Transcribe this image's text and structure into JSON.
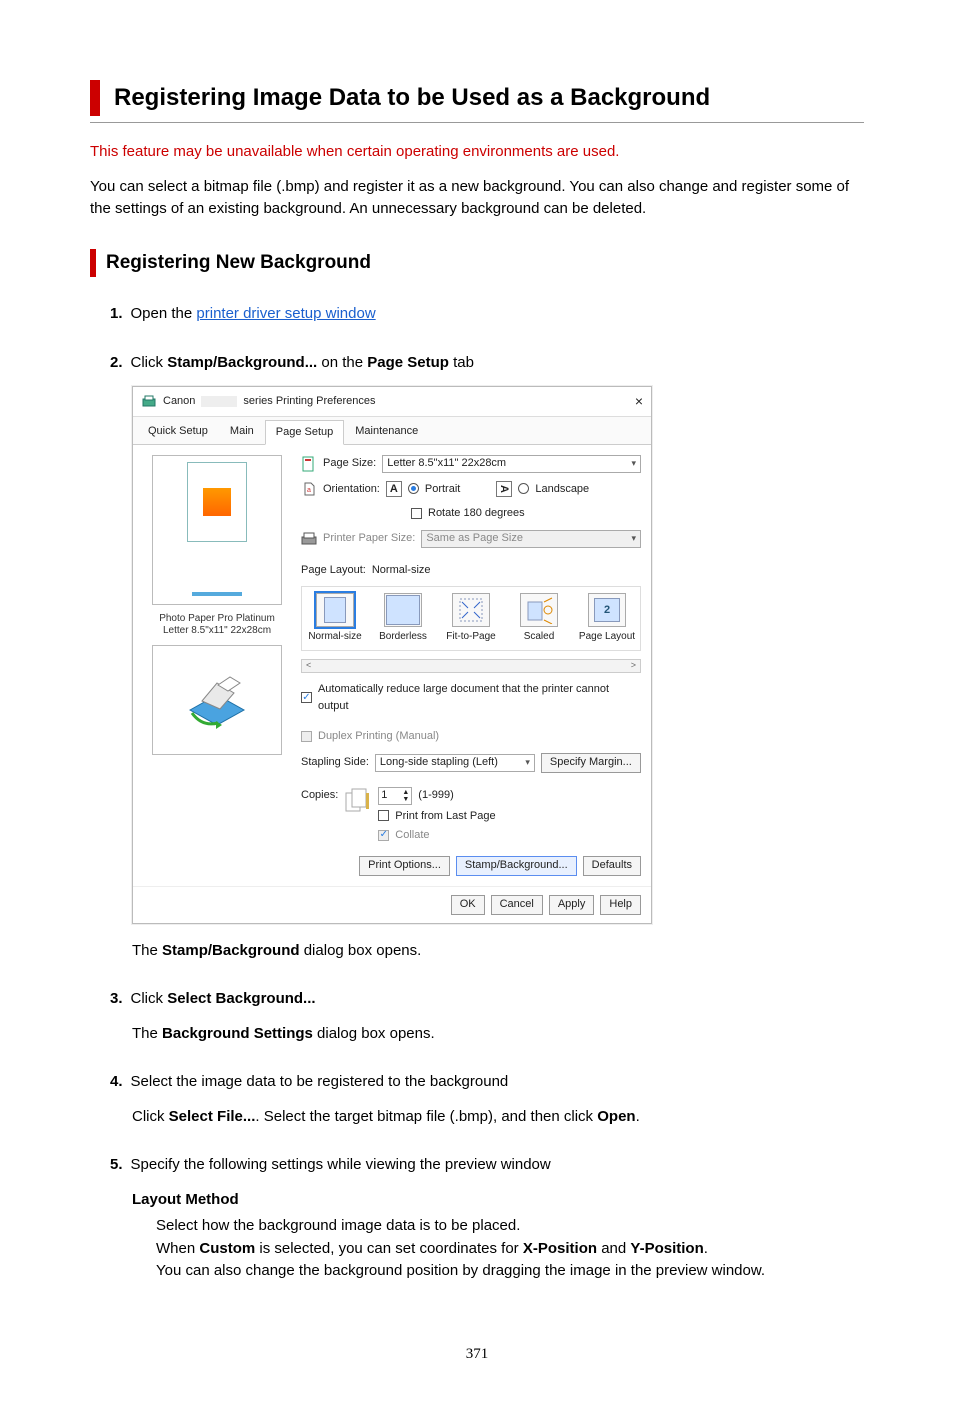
{
  "title": "Registering Image Data to be Used as a Background",
  "warning": "This feature may be unavailable when certain operating environments are used.",
  "intro": "You can select a bitmap file (.bmp) and register it as a new background. You can also change and register some of the settings of an existing background. An unnecessary background can be deleted.",
  "section_heading": "Registering New Background",
  "steps": {
    "s1": {
      "num": "1.",
      "pre": "Open the ",
      "link": "printer driver setup window"
    },
    "s2": {
      "num": "2.",
      "pre": "Click ",
      "b1": "Stamp/Background...",
      "mid": " on the ",
      "b2": "Page Setup",
      "post": " tab",
      "after_para_pre": "The ",
      "after_para_b": "Stamp/Background",
      "after_para_post": " dialog box opens."
    },
    "s3": {
      "num": "3.",
      "pre": "Click ",
      "b1": "Select Background...",
      "after_pre": "The ",
      "after_b": "Background Settings",
      "after_post": " dialog box opens."
    },
    "s4": {
      "num": "4.",
      "head": "Select the image data to be registered to the background",
      "body_pre": "Click ",
      "body_b1": "Select File...",
      "body_mid": ". Select the target bitmap file (.bmp), and then click ",
      "body_b2": "Open",
      "body_post": "."
    },
    "s5": {
      "num": "5.",
      "head": "Specify the following settings while viewing the preview window",
      "sub_heading": "Layout Method",
      "l1": "Select how the background image data is to be placed.",
      "l2_pre": "When ",
      "l2_b1": "Custom",
      "l2_mid": " is selected, you can set coordinates for ",
      "l2_b2": "X-Position",
      "l2_and": " and ",
      "l2_b3": "Y-Position",
      "l2_post": ".",
      "l3": "You can also change the background position by dragging the image in the preview window."
    }
  },
  "page_num": "371",
  "dialog": {
    "titlebar_prefix": "Canon",
    "titlebar_suffix": "series Printing Preferences",
    "tabs": {
      "t1": "Quick Setup",
      "t2": "Main",
      "t3": "Page Setup",
      "t4": "Maintenance"
    },
    "page_size_label": "Page Size:",
    "page_size_value": "Letter 8.5\"x11\" 22x28cm",
    "orientation_label": "Orientation:",
    "a_letter": "A",
    "portrait": "Portrait",
    "landscape": "Landscape",
    "rotate": "Rotate 180 degrees",
    "printer_paper_label": "Printer Paper Size:",
    "printer_paper_value": "Same as Page Size",
    "page_layout_label": "Page Layout:",
    "page_layout_value": "Normal-size",
    "layout_opts": {
      "o1": "Normal-size",
      "o2": "Borderless",
      "o3": "Fit-to-Page",
      "o4": "Scaled",
      "o5": "Page Layout"
    },
    "pl_num": "2",
    "auto_reduce": "Automatically reduce large document that the printer cannot output",
    "duplex": "Duplex Printing (Manual)",
    "stapling_label": "Stapling Side:",
    "stapling_value": "Long-side stapling (Left)",
    "specify_margin": "Specify Margin...",
    "copies_label": "Copies:",
    "copies_value": "1",
    "copies_range": "(1-999)",
    "print_last": "Print from Last Page",
    "collate": "Collate",
    "buttons": {
      "print_options": "Print Options...",
      "stamp_bg": "Stamp/Background...",
      "defaults": "Defaults",
      "ok": "OK",
      "cancel": "Cancel",
      "apply": "Apply",
      "help": "Help"
    },
    "left_media_l1": "Photo Paper Pro Platinum",
    "left_media_l2": "Letter 8.5\"x11\" 22x28cm",
    "scroll_left": "<",
    "scroll_right": ">"
  }
}
